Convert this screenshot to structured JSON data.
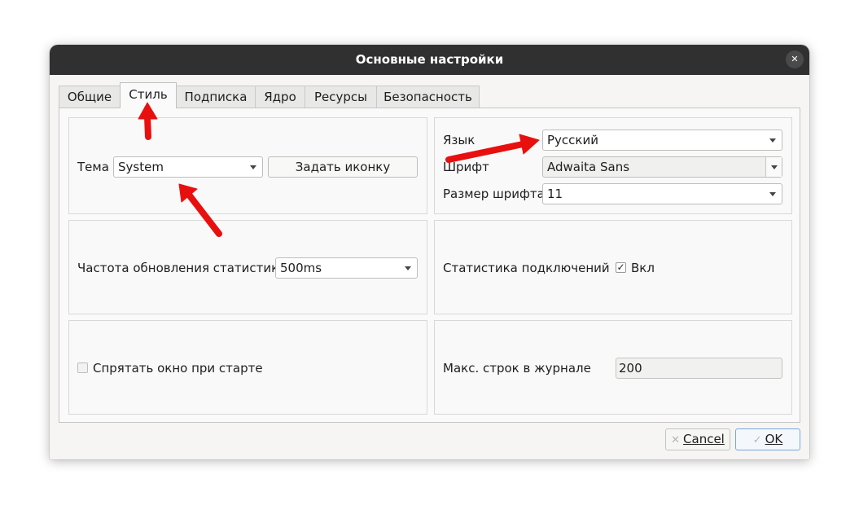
{
  "window": {
    "title": "Основные настройки",
    "close_glyph": "✕"
  },
  "tabs": [
    {
      "label": "Общие",
      "active": false
    },
    {
      "label": "Стиль",
      "active": true
    },
    {
      "label": "Подписка",
      "active": false
    },
    {
      "label": "Ядро",
      "active": false
    },
    {
      "label": "Ресурсы",
      "active": false
    },
    {
      "label": "Безопасность",
      "active": false
    }
  ],
  "style": {
    "theme_label": "Тема",
    "theme_value": "System",
    "set_icon_button": "Задать иконку",
    "language_label": "Язык",
    "language_value": "Русский",
    "font_label": "Шрифт",
    "font_value": "Adwaita Sans",
    "font_size_label": "Размер шрифта",
    "font_size_value": "11",
    "stats_rate_label": "Частота обновления статистики",
    "stats_rate_value": "500ms",
    "conn_stats_label": "Статистика подключений",
    "conn_stats_checkbox_label": "Вкл",
    "conn_stats_checked": true,
    "hide_on_start_label": "Спрятать окно при старте",
    "hide_on_start_checked": false,
    "max_log_lines_label": "Макс. строк в журнале",
    "max_log_lines_value": "200"
  },
  "buttons": {
    "cancel_label": "Cancel",
    "ok_label": "OK",
    "cancel_icon": "x-icon",
    "ok_icon": "check-icon"
  },
  "colors": {
    "titlebar": "#303030",
    "annotation_arrow": "#e8100f",
    "default_button_border": "#7aa6d8"
  }
}
